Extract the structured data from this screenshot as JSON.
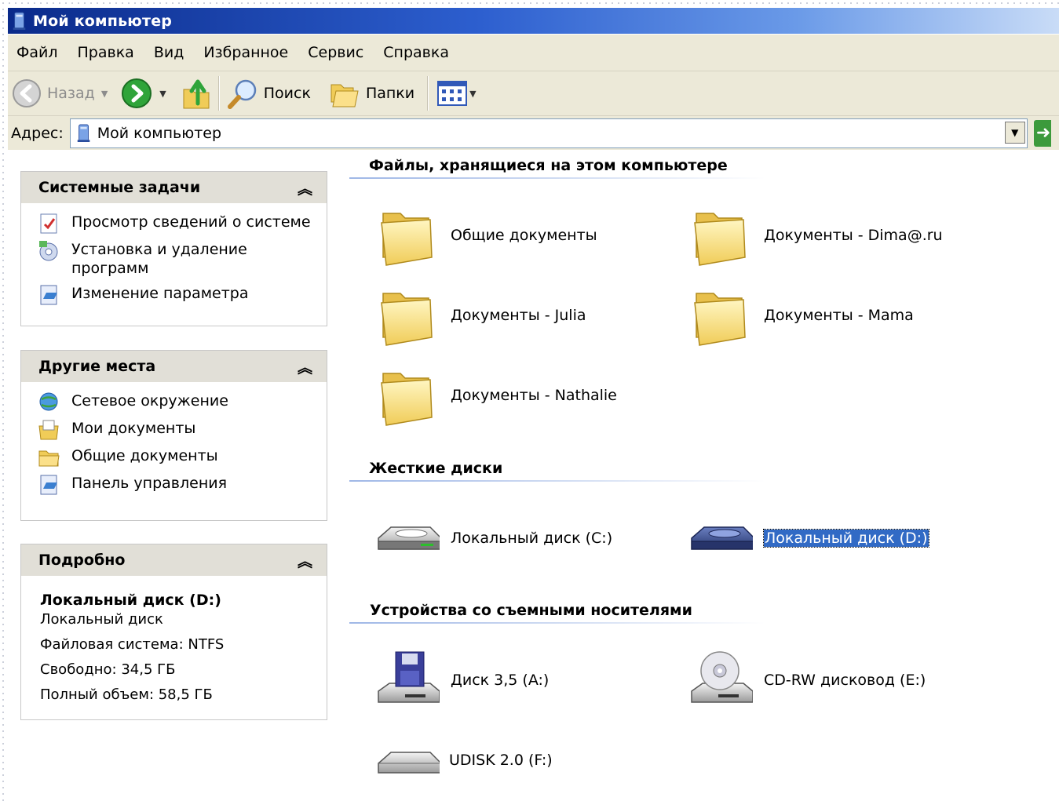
{
  "window": {
    "title": "Мой компьютер"
  },
  "menu": [
    "Файл",
    "Правка",
    "Вид",
    "Избранное",
    "Сервис",
    "Справка"
  ],
  "toolbar": {
    "back": "Назад",
    "search": "Поиск",
    "folders": "Папки"
  },
  "address": {
    "label": "Адрес:",
    "value": "Мой компьютер"
  },
  "panes": {
    "system": {
      "title": "Системные задачи",
      "items": [
        "Просмотр сведений о системе",
        "Установка и удаление программ",
        "Изменение параметра"
      ]
    },
    "places": {
      "title": "Другие места",
      "items": [
        "Сетевое окружение",
        "Мои документы",
        "Общие документы",
        "Панель управления"
      ]
    },
    "details": {
      "title": "Подробно",
      "name": "Локальный диск (D:)",
      "type": "Локальный диск",
      "fs": "Файловая система: NTFS",
      "free": "Свободно: 34,5 ГБ",
      "total": "Полный объем: 58,5 ГБ"
    }
  },
  "groups": {
    "files": {
      "title": "Файлы, хранящиеся на этом компьютере",
      "items": [
        "Общие документы",
        "Документы - Dima@.ru",
        "Документы - Julia",
        "Документы - Mama",
        "Документы - Nathalie"
      ]
    },
    "drives": {
      "title": "Жесткие диски",
      "items": [
        "Локальный диск (C:)",
        "Локальный диск (D:)"
      ],
      "selected": "Локальный диск (D:)"
    },
    "removable": {
      "title": "Устройства со съемными носителями",
      "items": [
        "Диск 3,5 (A:)",
        "CD-RW дисковод (E:)",
        "UDISK 2.0 (F:)"
      ]
    }
  },
  "colors": {
    "title_bar_start": "#0a2a8a",
    "chrome": "#ece9d8",
    "selection": "#316ac5",
    "pane_header": "#e1dfd7"
  }
}
